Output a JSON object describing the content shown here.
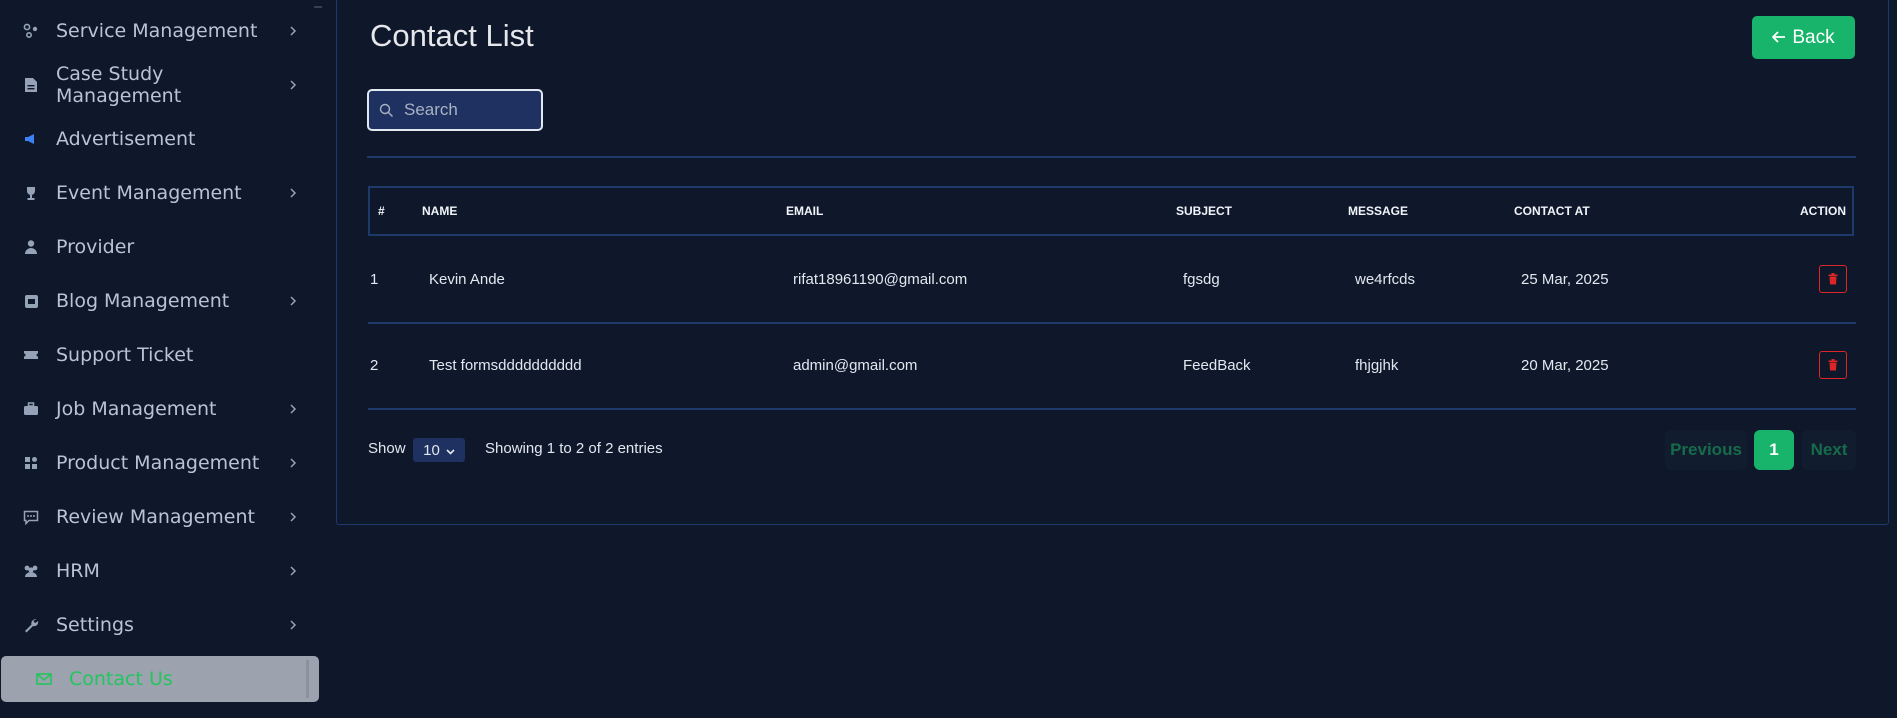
{
  "sidebar": {
    "items": [
      {
        "label": "Service Management",
        "icon": "services-icon",
        "has_chevron": true
      },
      {
        "label": "Case Study Management",
        "icon": "document-icon",
        "has_chevron": true
      },
      {
        "label": "Advertisement",
        "icon": "megaphone-icon",
        "has_chevron": false
      },
      {
        "label": "Event Management",
        "icon": "trophy-icon",
        "has_chevron": true
      },
      {
        "label": "Provider",
        "icon": "user-icon",
        "has_chevron": false
      },
      {
        "label": "Blog Management",
        "icon": "blog-icon",
        "has_chevron": true
      },
      {
        "label": "Support Ticket",
        "icon": "ticket-icon",
        "has_chevron": false
      },
      {
        "label": "Job Management",
        "icon": "briefcase-icon",
        "has_chevron": true
      },
      {
        "label": "Product Management",
        "icon": "grid-icon",
        "has_chevron": true
      },
      {
        "label": "Review Management",
        "icon": "review-icon",
        "has_chevron": true
      },
      {
        "label": "HRM",
        "icon": "users-icon",
        "has_chevron": true
      },
      {
        "label": "Settings",
        "icon": "wrench-icon",
        "has_chevron": true
      },
      {
        "label": "Contact Us",
        "icon": "envelope-icon",
        "has_chevron": false,
        "active": true
      }
    ]
  },
  "header": {
    "title": "Contact List",
    "back_label": "Back"
  },
  "search": {
    "placeholder": "Search"
  },
  "table": {
    "columns": [
      "#",
      "NAME",
      "EMAIL",
      "SUBJECT",
      "MESSAGE",
      "CONTACT AT",
      "ACTION"
    ],
    "rows": [
      {
        "index": "1",
        "name": "Kevin Ande",
        "email": "rifat18961190@gmail.com",
        "subject": "fgsdg",
        "message": "we4rfcds",
        "contact_at": "25 Mar, 2025"
      },
      {
        "index": "2",
        "name": "Test formsdddddddddd",
        "email": "admin@gmail.com",
        "subject": "FeedBack",
        "message": "fhjgjhk",
        "contact_at": "20 Mar, 2025"
      }
    ]
  },
  "footer": {
    "show_label": "Show",
    "page_size": "10",
    "showing_text": "Showing 1 to 2 of 2 entries",
    "prev_label": "Previous",
    "current_page": "1",
    "next_label": "Next"
  },
  "colors": {
    "background": "#0f172a",
    "accent": "#18b46b",
    "danger": "#dc2626",
    "border": "#1e3a6b"
  }
}
